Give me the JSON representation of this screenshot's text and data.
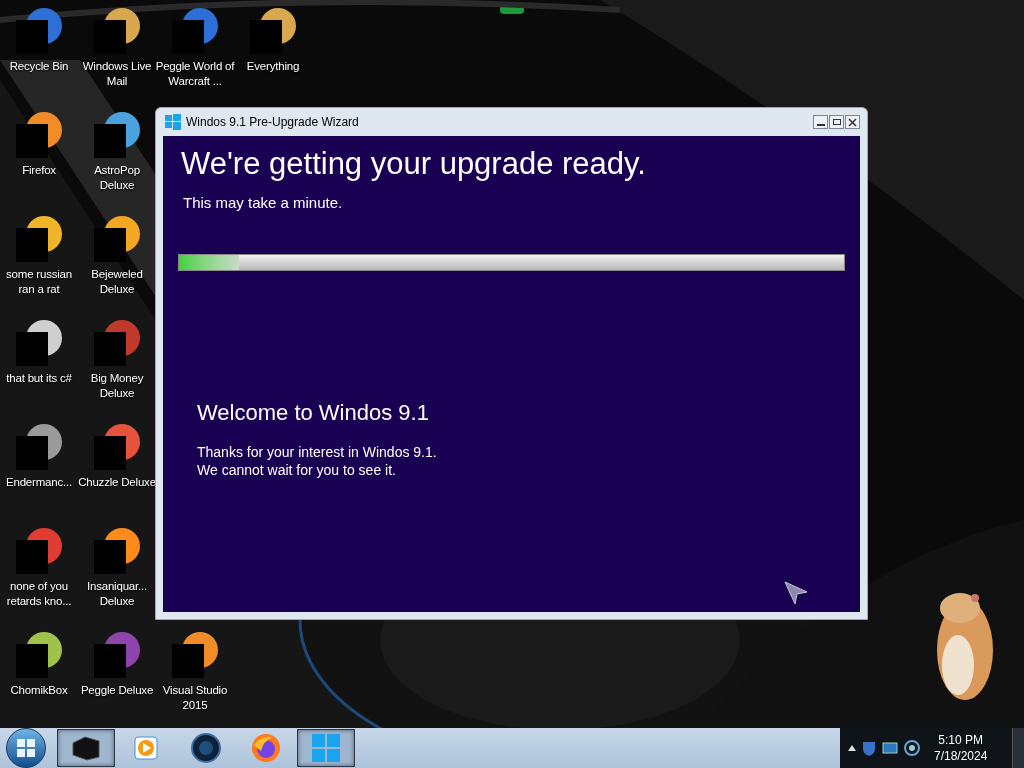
{
  "desktop_icons": [
    [
      {
        "label": "Recycle Bin"
      },
      {
        "label": "Firefox"
      },
      {
        "label": "some russian ran a rat"
      },
      {
        "label": "that but its c#"
      },
      {
        "label": "Endermanc..."
      },
      {
        "label": "none of you retards kno..."
      },
      {
        "label": "ChomikBox"
      }
    ],
    [
      {
        "label": "Windows Live Mail"
      },
      {
        "label": "AstroPop Deluxe"
      },
      {
        "label": "Bejeweled Deluxe"
      },
      {
        "label": "Big Money Deluxe"
      },
      {
        "label": "Chuzzle Deluxe"
      },
      {
        "label": "Insaniquar... Deluxe"
      },
      {
        "label": "Peggle Deluxe"
      }
    ],
    [
      {
        "label": "Peggle World of Warcraft ..."
      },
      {
        "label": "Visual Studio 2015"
      }
    ],
    [
      {
        "label": "Everything"
      }
    ]
  ],
  "window": {
    "title": "Windos 9.1 Pre-Upgrade Wizard",
    "heading": "We're getting your upgrade ready.",
    "subheading": "This may take a minute.",
    "progress": {
      "level": 0.09
    },
    "welcome_title": "Welcome to Windos 9.1",
    "welcome_lines": [
      "Thanks for your interest in Windos 9.1.",
      "We cannot wait for you to see it."
    ]
  },
  "taskbar": {
    "buttons": [
      {
        "kind": "box",
        "selected": true
      },
      {
        "kind": "media",
        "selected": false
      },
      {
        "kind": "globe",
        "selected": false
      },
      {
        "kind": "firefox",
        "selected": false
      },
      {
        "kind": "windows",
        "selected": true
      }
    ],
    "clock": {
      "time": "5:10 PM",
      "date": "7/18/2024"
    }
  }
}
